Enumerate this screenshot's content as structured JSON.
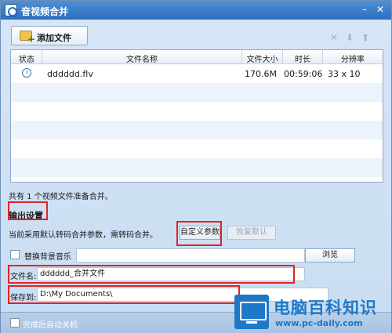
{
  "window": {
    "title": "音视频合并",
    "minimize_glyph": "–",
    "close_glyph": "✕"
  },
  "toolbar": {
    "add_file_label": "添加文件",
    "icons": [
      "delete-icon",
      "arrow-down-icon",
      "arrow-up-icon"
    ]
  },
  "table": {
    "columns": [
      "状态",
      "文件名称",
      "文件大小",
      "时长",
      "分辨率"
    ],
    "rows": [
      {
        "status_icon": "clock-icon",
        "name": "dddddd.flv",
        "size": "170.6M",
        "duration": "00:59:06",
        "resolution": "33 x 10"
      }
    ]
  },
  "summary": "共有 1 个视频文件准备合并。",
  "output": {
    "section_title": "输出设置",
    "params_text": "当前采用默认转码合并参数，需转码合并。",
    "custom_params_label": "自定义参数",
    "restore_default_label": "恢复默认",
    "replace_bgm_label": "替换背景音乐",
    "browse_label": "浏览",
    "filename_label": "文件名:",
    "filename_value": "dddddd_合并文件",
    "save_to_label": "保存到:",
    "save_to_value": "D:\\My Documents\\"
  },
  "footer": {
    "auto_shutdown_label": "完成后自动关机"
  },
  "watermark": {
    "title": "电脑百科知识",
    "url": "www.pc-daily.com"
  },
  "colors": {
    "highlight_box": "#e02424",
    "brand_blue": "#1d78c8",
    "titlebar": "#2c6fc0"
  }
}
